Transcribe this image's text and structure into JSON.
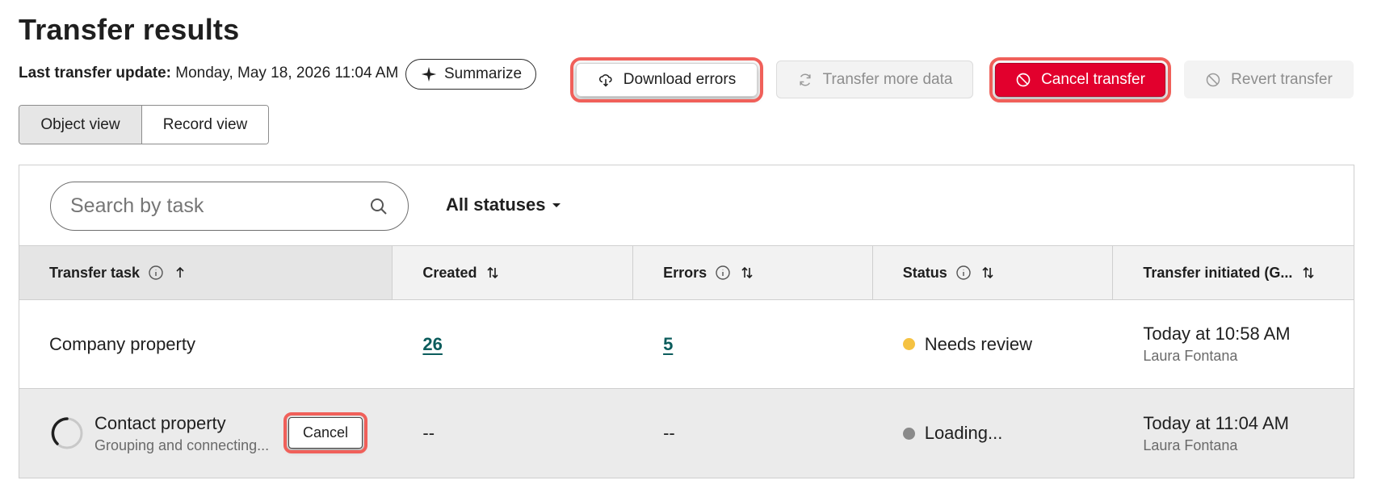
{
  "page": {
    "title": "Transfer results"
  },
  "last_update": {
    "label": "Last transfer update:",
    "value": "Monday, May 18, 2026 11:04 AM"
  },
  "summarize": {
    "label": "Summarize",
    "icon": "sparkle-icon"
  },
  "actions": {
    "download_errors": "Download errors",
    "transfer_more_data": "Transfer more data",
    "cancel_transfer": "Cancel transfer",
    "revert_transfer": "Revert transfer"
  },
  "view_toggle": {
    "object_view": "Object view",
    "record_view": "Record view",
    "selected": "Object view"
  },
  "search": {
    "placeholder": "Search by task",
    "value": ""
  },
  "status_filter": {
    "label": "All statuses"
  },
  "table": {
    "columns": [
      {
        "label": "Transfer task",
        "info": true,
        "sort": "ascending"
      },
      {
        "label": "Created",
        "info": false,
        "sort": "none"
      },
      {
        "label": "Errors",
        "info": true,
        "sort": "none"
      },
      {
        "label": "Status",
        "info": true,
        "sort": "none"
      },
      {
        "label": "Transfer initiated (G...",
        "info": false,
        "sort": "none"
      }
    ],
    "rows": [
      {
        "task": "Company property",
        "created": "26",
        "errors": "5",
        "status": "Needs review",
        "status_color": "#f5c242",
        "initiated": "Today at 10:58 AM",
        "initiated_by": "Laura Fontana"
      },
      {
        "task": "Contact property",
        "task_sub": "Grouping and connecting...",
        "cancel_label": "Cancel",
        "created": "--",
        "errors": "--",
        "status": "Loading...",
        "status_color": "#8a8a8a",
        "initiated": "Today at 11:04 AM",
        "initiated_by": "Laura Fontana"
      }
    ]
  },
  "colors": {
    "danger": "#e2002d",
    "link": "#0b5c5c",
    "highlight": "#f0605a"
  }
}
